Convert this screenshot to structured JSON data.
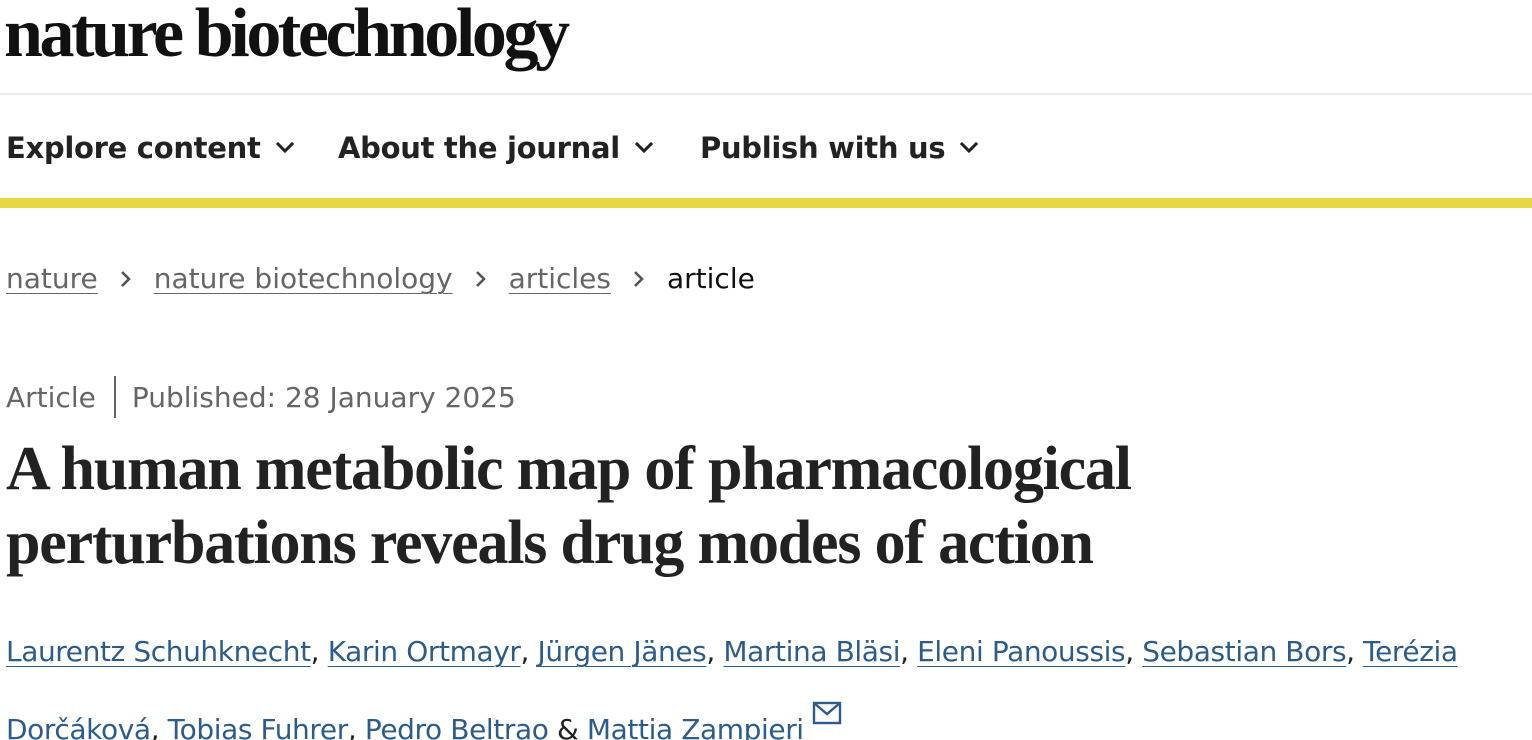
{
  "site": {
    "logo_text": "nature biotechnology"
  },
  "nav": {
    "items": [
      {
        "label": "Explore content",
        "icon": "chevron-down-icon"
      },
      {
        "label": "About the journal",
        "icon": "chevron-down-icon"
      },
      {
        "label": "Publish with us",
        "icon": "chevron-down-icon"
      }
    ],
    "accent_color": "#e8d642"
  },
  "breadcrumb": {
    "items": [
      {
        "label": "nature",
        "link": true
      },
      {
        "label": "nature biotechnology",
        "link": true
      },
      {
        "label": "articles",
        "link": true
      },
      {
        "label": "article",
        "link": false
      }
    ],
    "separator_icon": "chevron-right-icon"
  },
  "article": {
    "type": "Article",
    "published": "Published: 28 January 2025",
    "title_line1": "A human metabolic map of pharmacological",
    "title_line2": "perturbations reveals drug modes of action",
    "authors": [
      "Laurentz Schuhknecht",
      "Karin Ortmayr",
      "Jürgen Jänes",
      "Martina Bläsi",
      "Eleni Panoussis",
      "Sebastian Bors",
      "Terézia Dorčáková",
      "Tobias Fuhrer",
      "Pedro Beltrao",
      "Mattia Zampieri"
    ],
    "author_separator": ", ",
    "last_author_joiner": " & ",
    "contact_icon": "mail-icon",
    "link_color": "#2e5c8a"
  }
}
